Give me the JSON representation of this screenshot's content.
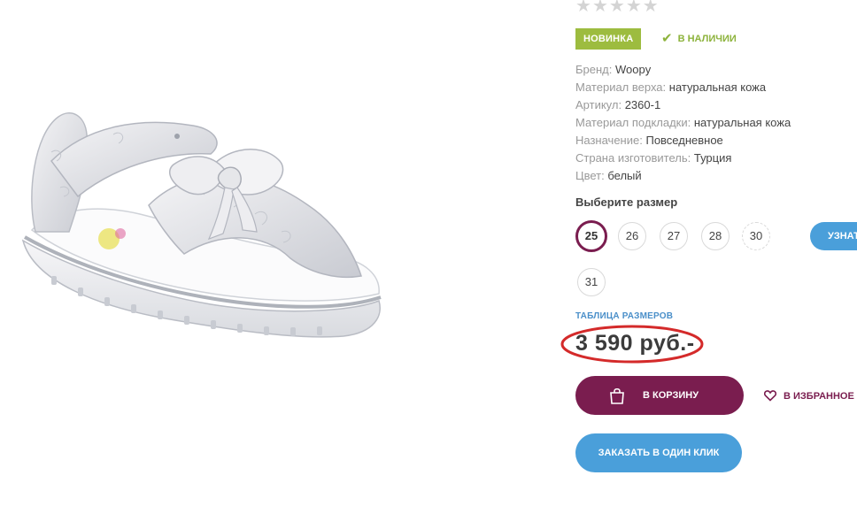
{
  "product": {
    "image_alt": "white leather sandal with bow",
    "rating": {
      "stars_filled": 0,
      "stars_total": 5
    },
    "badge_new": "НОВИНКА",
    "stock": {
      "label": "В НАЛИЧИИ",
      "icon": "check-icon"
    },
    "properties": [
      {
        "key": "Бренд:",
        "value": "Woopy"
      },
      {
        "key": "Материал верха:",
        "value": "натуральная кожа"
      },
      {
        "key": "Артикул:",
        "value": "2360-1"
      },
      {
        "key": "Материал подкладки:",
        "value": "натуральная кожа"
      },
      {
        "key": "Назначение:",
        "value": "Повседневное"
      },
      {
        "key": "Страна изготовитель:",
        "value": "Турция"
      },
      {
        "key": "Цвет:",
        "value": "белый"
      }
    ],
    "size_title": "Выберите размер",
    "sizes": [
      "25",
      "26",
      "27",
      "28",
      "30",
      "31"
    ],
    "selected_size": "25",
    "learn_button": "УЗНАТЬ",
    "size_table_link": "ТАБЛИЦА РАЗМЕРОВ",
    "price": "3 590 руб.-",
    "cart_button": "В КОРЗИНУ",
    "favorites_button": "В ИЗБРАННОЕ",
    "one_click_button": "ЗАКАЗАТЬ В ОДИН КЛИК"
  },
  "colors": {
    "primary": "#7a1d4f",
    "accent_blue": "#4a9fda",
    "badge_green": "#9dbc3f",
    "annotation_red": "#d42a2a"
  }
}
